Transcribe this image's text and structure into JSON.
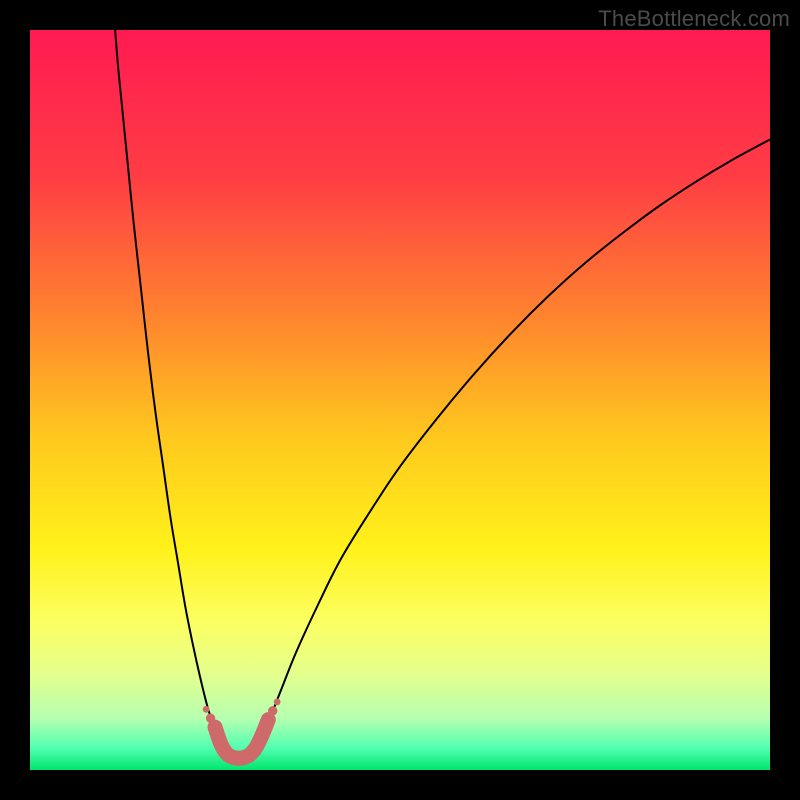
{
  "watermark": "TheBottleneck.com",
  "chart_data": {
    "type": "line",
    "title": "",
    "xlabel": "",
    "ylabel": "",
    "x_range": [
      0,
      1
    ],
    "y_range": [
      0,
      1
    ],
    "grid": false,
    "legend": false,
    "background_gradient": {
      "stops": [
        {
          "pos": 0.0,
          "color": "#ff1a52"
        },
        {
          "pos": 0.2,
          "color": "#ff3d44"
        },
        {
          "pos": 0.4,
          "color": "#ff892d"
        },
        {
          "pos": 0.55,
          "color": "#ffc81e"
        },
        {
          "pos": 0.7,
          "color": "#fff11a"
        },
        {
          "pos": 0.8,
          "color": "#fcff62"
        },
        {
          "pos": 0.87,
          "color": "#e4ff8d"
        },
        {
          "pos": 0.93,
          "color": "#b6ffb0"
        },
        {
          "pos": 0.97,
          "color": "#52ffb0"
        },
        {
          "pos": 1.0,
          "color": "#00e66e"
        }
      ]
    },
    "series": [
      {
        "name": "left-curve",
        "stroke": "#000000",
        "stroke_width": 2,
        "points": [
          {
            "x": 0.115,
            "y": 1.0
          },
          {
            "x": 0.12,
            "y": 0.94
          },
          {
            "x": 0.13,
            "y": 0.84
          },
          {
            "x": 0.14,
            "y": 0.74
          },
          {
            "x": 0.15,
            "y": 0.65
          },
          {
            "x": 0.16,
            "y": 0.56
          },
          {
            "x": 0.17,
            "y": 0.48
          },
          {
            "x": 0.18,
            "y": 0.41
          },
          {
            "x": 0.19,
            "y": 0.34
          },
          {
            "x": 0.2,
            "y": 0.28
          },
          {
            "x": 0.21,
            "y": 0.22
          },
          {
            "x": 0.22,
            "y": 0.17
          },
          {
            "x": 0.23,
            "y": 0.125
          },
          {
            "x": 0.24,
            "y": 0.085
          },
          {
            "x": 0.25,
            "y": 0.055
          },
          {
            "x": 0.258,
            "y": 0.035
          }
        ]
      },
      {
        "name": "right-curve",
        "stroke": "#000000",
        "stroke_width": 2,
        "points": [
          {
            "x": 0.308,
            "y": 0.035
          },
          {
            "x": 0.32,
            "y": 0.06
          },
          {
            "x": 0.34,
            "y": 0.11
          },
          {
            "x": 0.36,
            "y": 0.16
          },
          {
            "x": 0.39,
            "y": 0.225
          },
          {
            "x": 0.42,
            "y": 0.285
          },
          {
            "x": 0.46,
            "y": 0.35
          },
          {
            "x": 0.5,
            "y": 0.41
          },
          {
            "x": 0.55,
            "y": 0.475
          },
          {
            "x": 0.6,
            "y": 0.535
          },
          {
            "x": 0.65,
            "y": 0.59
          },
          {
            "x": 0.7,
            "y": 0.64
          },
          {
            "x": 0.75,
            "y": 0.685
          },
          {
            "x": 0.8,
            "y": 0.725
          },
          {
            "x": 0.85,
            "y": 0.762
          },
          {
            "x": 0.9,
            "y": 0.795
          },
          {
            "x": 0.95,
            "y": 0.825
          },
          {
            "x": 1.0,
            "y": 0.852
          }
        ]
      },
      {
        "name": "highlight-valley",
        "stroke": "#cf6a6a",
        "stroke_width": 15,
        "linecap": "round",
        "points": [
          {
            "x": 0.25,
            "y": 0.058
          },
          {
            "x": 0.258,
            "y": 0.035
          },
          {
            "x": 0.266,
            "y": 0.022
          },
          {
            "x": 0.275,
            "y": 0.017
          },
          {
            "x": 0.285,
            "y": 0.016
          },
          {
            "x": 0.296,
            "y": 0.02
          },
          {
            "x": 0.305,
            "y": 0.03
          },
          {
            "x": 0.314,
            "y": 0.048
          },
          {
            "x": 0.322,
            "y": 0.068
          }
        ]
      }
    ]
  }
}
